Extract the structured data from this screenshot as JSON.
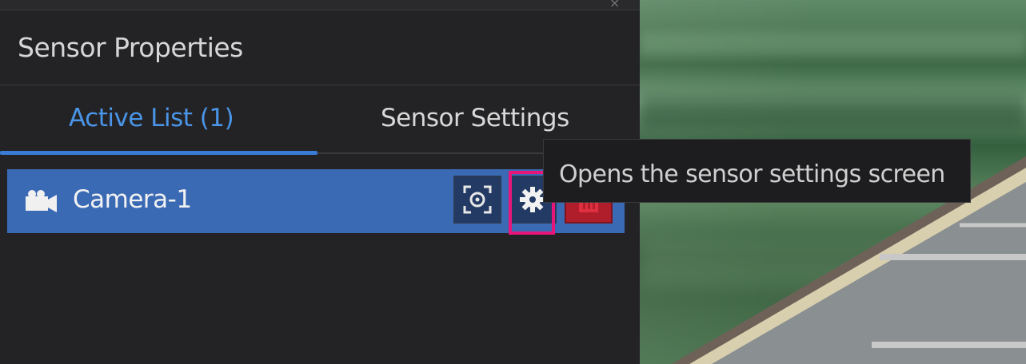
{
  "panel": {
    "title": "Sensor Properties",
    "close_glyph": "×"
  },
  "tabs": [
    {
      "label": "Active List  (1)",
      "active": true
    },
    {
      "label": "Sensor Settings",
      "active": false
    }
  ],
  "sensors": [
    {
      "name": "Camera-1",
      "type_icon": "camera-icon",
      "actions": [
        {
          "name": "focus-sensor-button",
          "icon": "focus-target-icon"
        },
        {
          "name": "sensor-settings-button",
          "icon": "gear-icon"
        },
        {
          "name": "delete-sensor-button",
          "icon": "trash-icon"
        }
      ]
    }
  ],
  "tooltip": {
    "text": "Opens the sensor settings screen"
  },
  "colors": {
    "accent": "#3a7bd5",
    "row_selected": "#3b6ab5",
    "delete": "#b01e2c",
    "highlight": "#e8157a"
  }
}
